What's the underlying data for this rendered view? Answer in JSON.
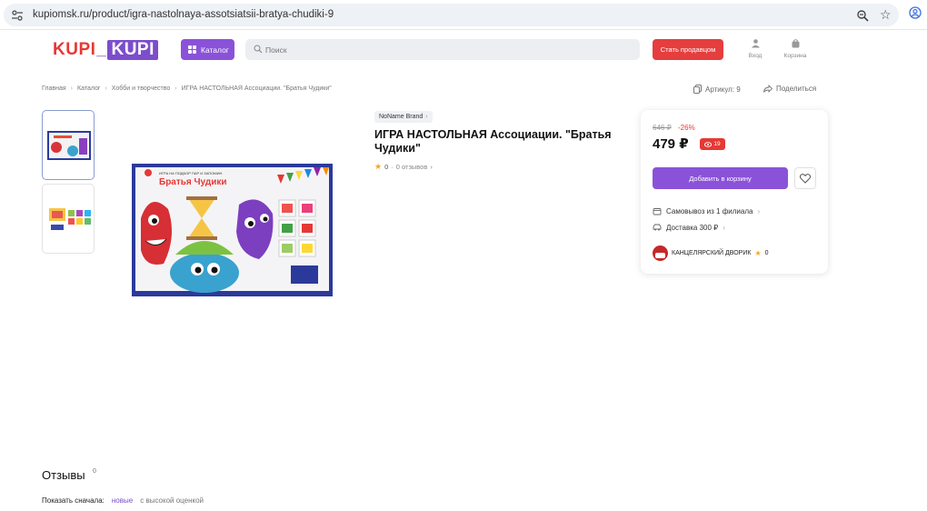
{
  "browser": {
    "url": "kupiomsk.ru/product/igra-nastolnaya-assotsiatsii-bratya-chudiki-9"
  },
  "header": {
    "logo_left": "KUPI",
    "logo_sep": "_",
    "logo_right": "KUPI",
    "catalog_label": "Каталог",
    "search_placeholder": "Поиск",
    "seller_label": "Стать продавцом",
    "login_label": "Вход",
    "cart_label": "Корзина"
  },
  "breadcrumb": [
    "Главная",
    "Каталог",
    "Хобби и творчество",
    "ИГРА НАСТОЛЬНАЯ Ассоциации. \"Братья Чудики\""
  ],
  "meta": {
    "article": "Артикул: 9",
    "share": "Поделиться"
  },
  "product": {
    "brand": "NoName Brand",
    "title": "ИГРА НАСТОЛЬНАЯ Ассоциации. \"Братья Чудики\"",
    "rating": "0",
    "reviews": "0 отзывов",
    "box_title": "Братья Чудики",
    "box_subtitle": "ИГРА НА ПОДБОР ПАР И ЗАПОМИН"
  },
  "buy": {
    "old_price": "646 ₽",
    "discount": "-26%",
    "price": "479 ₽",
    "promo_count": "19",
    "cart_button": "Добавить в корзину",
    "pickup": "Самовывоз из 1 филиала",
    "delivery": "Доставка 300 ₽",
    "shop_name": "КАНЦЕЛЯРСКИЙ ДВОРИК",
    "shop_rating": "0"
  },
  "reviews_section": {
    "title": "Отзывы",
    "count": "0",
    "sort_label": "Показать сначала:",
    "sort_new": "новые",
    "sort_high": "с высокой оценкой"
  },
  "colors": {
    "accent": "#8a52d9",
    "red": "#e53935"
  }
}
